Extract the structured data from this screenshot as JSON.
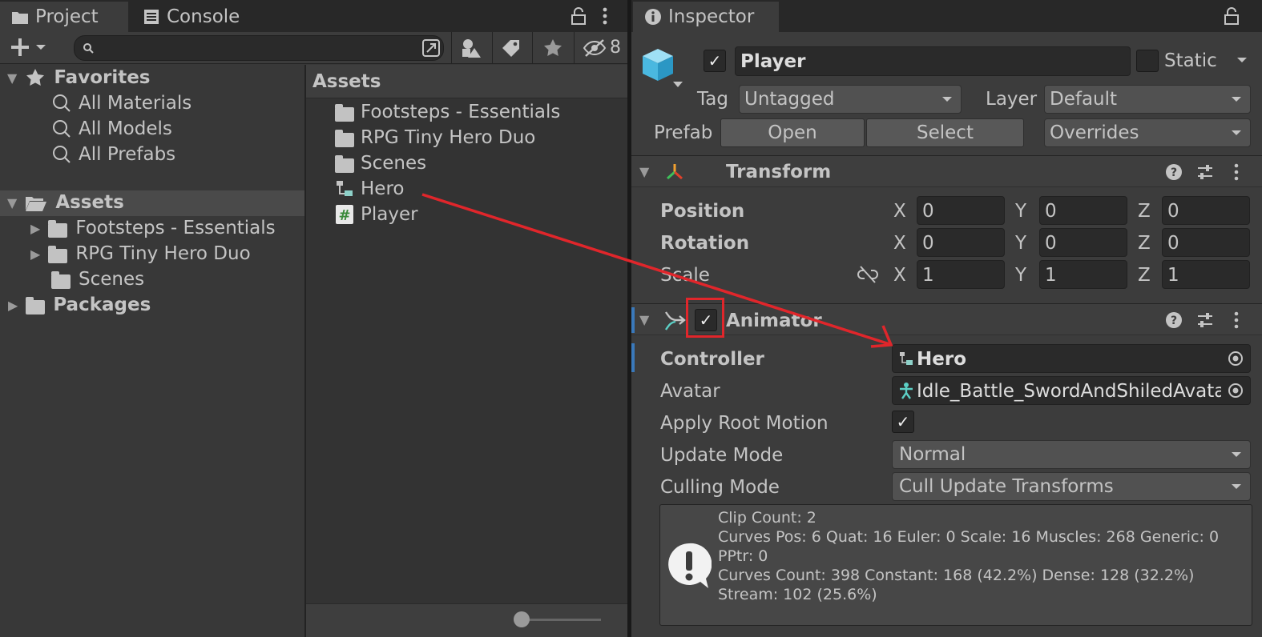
{
  "project_panel": {
    "tabs": [
      {
        "label": "Project",
        "icon": "folder-icon",
        "active": true
      },
      {
        "label": "Console",
        "icon": "console-icon",
        "active": false
      }
    ],
    "hidden_count": "8",
    "tree": {
      "favorites": {
        "label": "Favorites",
        "items": [
          "All Materials",
          "All Models",
          "All Prefabs"
        ]
      },
      "assets": {
        "label": "Assets",
        "children": [
          "Footsteps - Essentials",
          "RPG Tiny Hero Duo",
          "Scenes"
        ]
      },
      "packages": {
        "label": "Packages"
      }
    },
    "assets_view": {
      "header": "Assets",
      "items": [
        {
          "label": "Footsteps - Essentials",
          "icon": "folder-icon"
        },
        {
          "label": "RPG Tiny Hero Duo",
          "icon": "folder-icon"
        },
        {
          "label": "Scenes",
          "icon": "folder-icon"
        },
        {
          "label": "Hero",
          "icon": "animator-controller-icon"
        },
        {
          "label": "Player",
          "icon": "script-icon"
        }
      ]
    }
  },
  "inspector": {
    "tab_label": "Inspector",
    "object_name": "Player",
    "static_label": "Static",
    "tag_label": "Tag",
    "tag_value": "Untagged",
    "layer_label": "Layer",
    "layer_value": "Default",
    "prefab_label": "Prefab",
    "prefab_open": "Open",
    "prefab_select": "Select",
    "prefab_overrides": "Overrides",
    "transform": {
      "title": "Transform",
      "rows": [
        {
          "label": "Position",
          "x": "0",
          "y": "0",
          "z": "0"
        },
        {
          "label": "Rotation",
          "x": "0",
          "y": "0",
          "z": "0"
        },
        {
          "label": "Scale",
          "x": "1",
          "y": "1",
          "z": "1"
        }
      ],
      "axis_x": "X",
      "axis_y": "Y",
      "axis_z": "Z"
    },
    "animator": {
      "title": "Animator",
      "controller_label": "Controller",
      "controller_value": "Hero",
      "avatar_label": "Avatar",
      "avatar_value": "Idle_Battle_SwordAndShiledAvatar",
      "apply_root_motion_label": "Apply Root Motion",
      "update_mode_label": "Update Mode",
      "update_mode_value": "Normal",
      "culling_mode_label": "Culling Mode",
      "culling_mode_value": "Cull Update Transforms",
      "info_lines": [
        "Clip Count: 2",
        "Curves Pos: 6 Quat: 16 Euler: 0 Scale: 16 Muscles: 268 Generic: 0",
        "PPtr: 0",
        "Curves Count: 398 Constant: 168 (42.2%) Dense: 128 (32.2%)",
        "Stream: 102 (25.6%)"
      ]
    }
  },
  "colors": {
    "annotation": "#e0262b",
    "accent_blue": "#3a79bb"
  }
}
